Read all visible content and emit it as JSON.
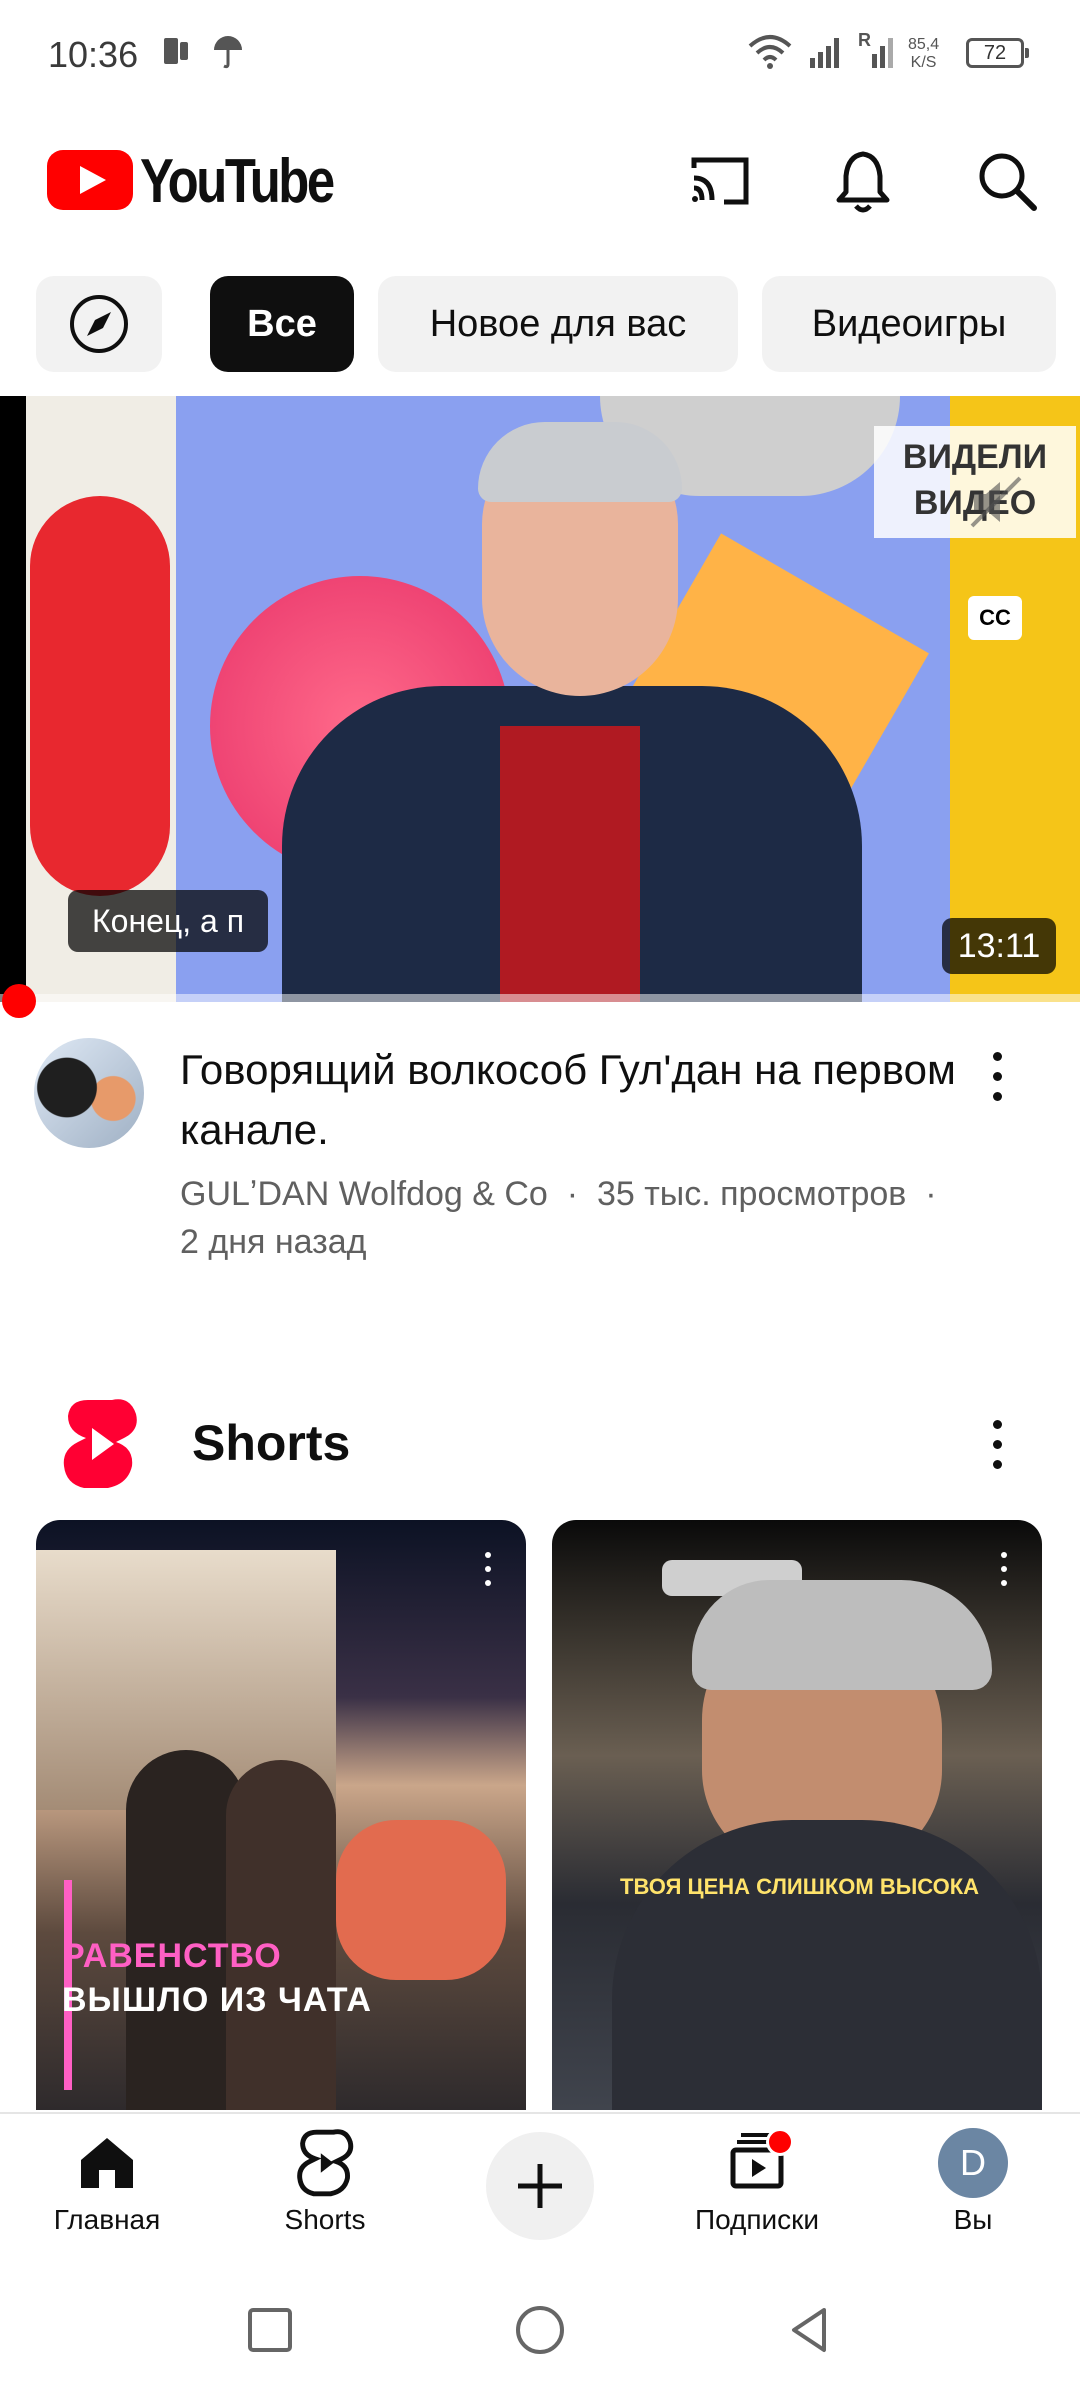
{
  "status_bar": {
    "time": "10:36",
    "net_speed_value": "85,4",
    "net_speed_unit": "K/S",
    "battery": "72",
    "signal_label": "R"
  },
  "header": {
    "logo_text": "YouTube",
    "icons": [
      "cast-icon",
      "notifications-bell-icon",
      "search-icon"
    ],
    "brand_color": "#ff0000"
  },
  "chips": [
    {
      "label": "",
      "icon": "explore-compass-icon"
    },
    {
      "label": "Все",
      "active": true
    },
    {
      "label": "Новое для вас",
      "active": false
    },
    {
      "label": "Видеоигры",
      "active": false
    }
  ],
  "video": {
    "caption": "Конец, а п",
    "duration": "13:11",
    "watermark": "ВИДЕЛИ ВИДЕО",
    "title": "Говорящий волкособ Гул'дан на первом канале.",
    "channel": "GULʼDAN Wolfdog & Co",
    "views": "35 тыс. просмотров",
    "age": "2 дня назад"
  },
  "shorts": {
    "section_title": "Shorts",
    "items": [
      {
        "overlay_line1": "РАВЕНСТВО",
        "overlay_line2": "ВЫШЛО ИЗ ЧАТА"
      },
      {
        "overlay_line1": "ТВОЯ ЦЕНА СЛИШКОМ ВЫСОКА"
      }
    ]
  },
  "bottom_nav": {
    "items": [
      {
        "label": "Главная",
        "icon": "home-icon",
        "active": true
      },
      {
        "label": "Shorts",
        "icon": "shorts-icon"
      },
      {
        "label": "",
        "icon": "create-plus-icon"
      },
      {
        "label": "Подписки",
        "icon": "subscriptions-icon"
      },
      {
        "label": "Вы",
        "icon": "avatar",
        "avatar_letter": "D"
      }
    ]
  }
}
